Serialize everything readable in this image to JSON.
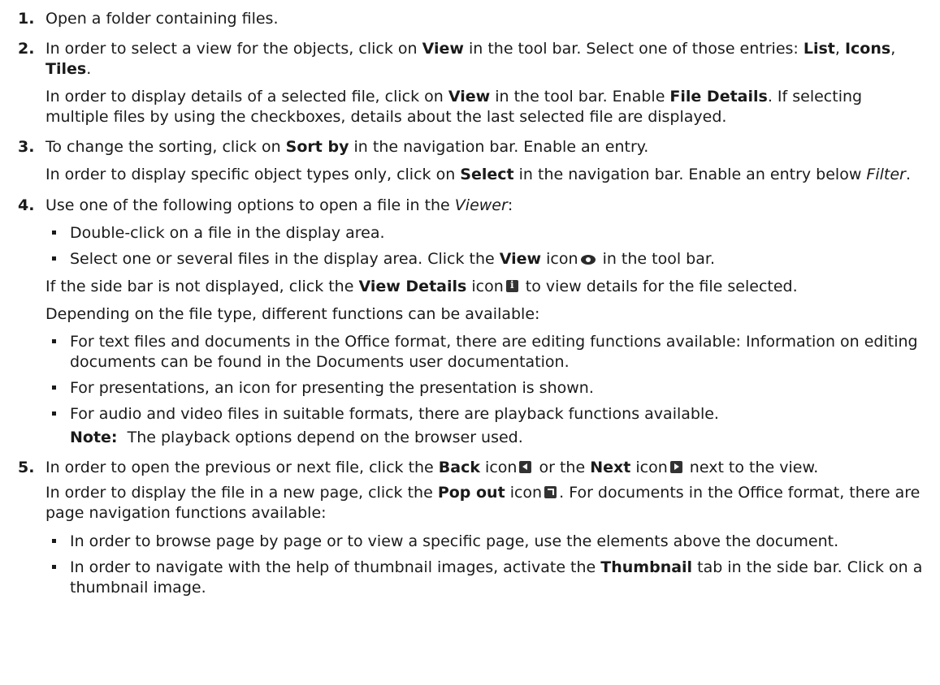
{
  "steps": [
    {
      "num": "1.",
      "text": "Open a folder containing files."
    },
    {
      "num": "2.",
      "p1": {
        "a": "In order to select a view for the objects, click on ",
        "b": "View",
        "c": " in the tool bar. Select one of those entries: ",
        "d": "List",
        "e": ", ",
        "f": "Icons",
        "g": ", ",
        "h": "Tiles",
        "i": "."
      },
      "p2": {
        "a": "In order to display details of a selected file, click on ",
        "b": "View",
        "c": " in the tool bar. Enable ",
        "d": "File Details",
        "e": ". If selecting multiple files by using the checkboxes, details about the last selected file are displayed."
      }
    },
    {
      "num": "3.",
      "p1": {
        "a": "To change the sorting, click on ",
        "b": "Sort by",
        "c": " in the navigation bar. Enable an entry."
      },
      "p2": {
        "a": "In order to display specific object types only, click on ",
        "b": "Select",
        "c": " in the navigation bar. Enable an entry below ",
        "d": "Filter",
        "e": "."
      }
    },
    {
      "num": "4.",
      "p1": {
        "a": "Use one of the following options to open a file in the ",
        "b": "Viewer",
        "c": ":"
      },
      "bullets1": [
        {
          "a": "Double-click on a file in the display area."
        },
        {
          "a": "Select one or several files in the display area. Click the ",
          "b": "View",
          "c": " icon",
          "d": " in the tool bar."
        }
      ],
      "p2": {
        "a": "If the side bar is not displayed, click the ",
        "b": "View Details",
        "c": " icon",
        "d": " to view details for the file selected."
      },
      "p3": "Depending on the file type, different functions can be available:",
      "bullets2": [
        "For text files and documents in the Office format, there are editing functions available: Information on editing documents can be found in the Documents user documentation.",
        "For presentations, an icon for presenting the presentation is shown.",
        "For audio and video files in suitable formats, there are playback functions available."
      ],
      "note": {
        "label": "Note:",
        "text": "  The playback options depend on the browser used."
      }
    },
    {
      "num": "5.",
      "p1": {
        "a": "In order to open the previous or next file, click the ",
        "b": "Back",
        "c": " icon",
        "d": " or the ",
        "e": "Next",
        "f": " icon",
        "g": " next to the view."
      },
      "p2": {
        "a": "In order to display the file in a new page, click the ",
        "b": "Pop out",
        "c": " icon",
        "d": ". For documents in the Office format, there are page navigation functions available:"
      },
      "bullets": [
        {
          "a": "In order to browse page by page or to view a specific page, use the elements above the document."
        },
        {
          "a": "In order to navigate with the help of thumbnail images, activate the ",
          "b": "Thumbnail",
          "c": " tab in the side bar. Click on a thumbnail image."
        }
      ]
    }
  ]
}
